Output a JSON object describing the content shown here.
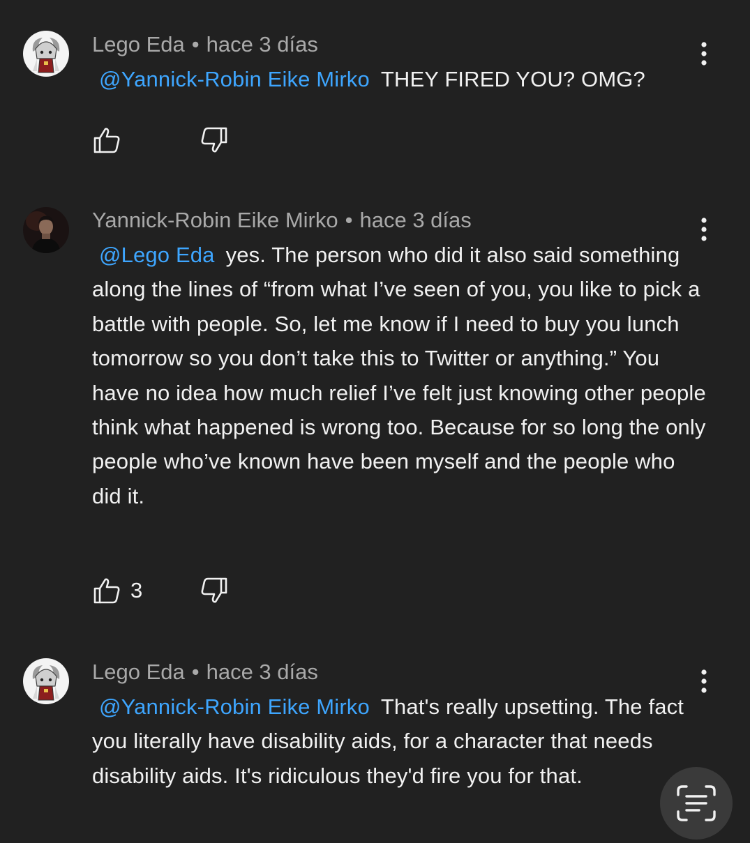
{
  "comments": [
    {
      "author": "Lego Eda",
      "separator": "•",
      "time": "hace 3 días",
      "mention": "@Yannick-Robin Eike Mirko",
      "text": "THEY FIRED YOU? OMG?",
      "likes": ""
    },
    {
      "author": "Yannick-Robin Eike Mirko",
      "separator": "•",
      "time": "hace 3 días",
      "mention": "@Lego Eda",
      "text": "yes. The person who did it also said something along the lines of “from what I’ve seen of you, you like to pick a battle with people. So, let me know if I need to buy you lunch tomorrow so you don’t take this to Twitter or anything.” You have no idea how much relief I’ve felt just knowing other people think what happened is wrong too. Because for so long the only people who’ve known have been myself and the people who did it.",
      "likes": "3"
    },
    {
      "author": "Lego Eda",
      "separator": "•",
      "time": "hace 3 días",
      "mention": "@Yannick-Robin Eike Mirko",
      "text": "That's really upsetting. The fact you literally have disability aids, for a character that needs disability aids. It's ridiculous they'd fire you for that.",
      "likes": ""
    }
  ],
  "icons": {
    "like": "thumbs-up-icon",
    "dislike": "thumbs-down-icon",
    "more": "more-vertical-icon",
    "lens": "text-scan-icon"
  },
  "colors": {
    "background": "#212121",
    "mention": "#3ea6ff",
    "meta": "#a9a9a9",
    "text": "#f1f1f1"
  }
}
